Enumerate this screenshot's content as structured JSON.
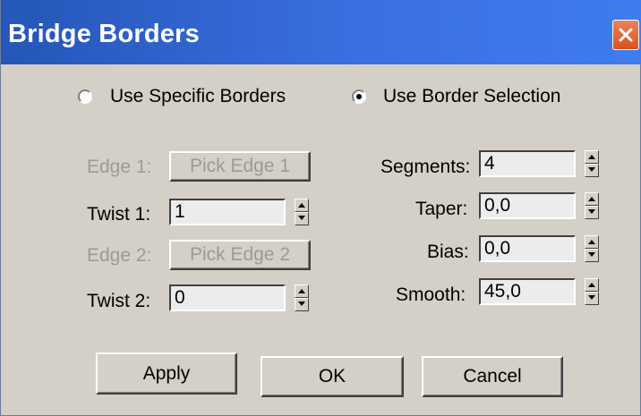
{
  "window": {
    "title": "Bridge Borders"
  },
  "mode": {
    "options": [
      {
        "label": "Use Specific Borders",
        "selected": false
      },
      {
        "label": "Use Border Selection",
        "selected": true
      }
    ]
  },
  "left": {
    "edge1_label": "Edge 1:",
    "edge1_button": "Pick Edge 1",
    "twist1_label": "Twist 1:",
    "twist1_value": "1",
    "edge2_label": "Edge 2:",
    "edge2_button": "Pick Edge 2",
    "twist2_label": "Twist 2:",
    "twist2_value": "0"
  },
  "right": {
    "segments_label": "Segments:",
    "segments_value": "4",
    "taper_label": "Taper:",
    "taper_value": "0,0",
    "bias_label": "Bias:",
    "bias_value": "0,0",
    "smooth_label": "Smooth:",
    "smooth_value": "45,0"
  },
  "buttons": {
    "apply": "Apply",
    "ok": "OK",
    "cancel": "Cancel"
  }
}
